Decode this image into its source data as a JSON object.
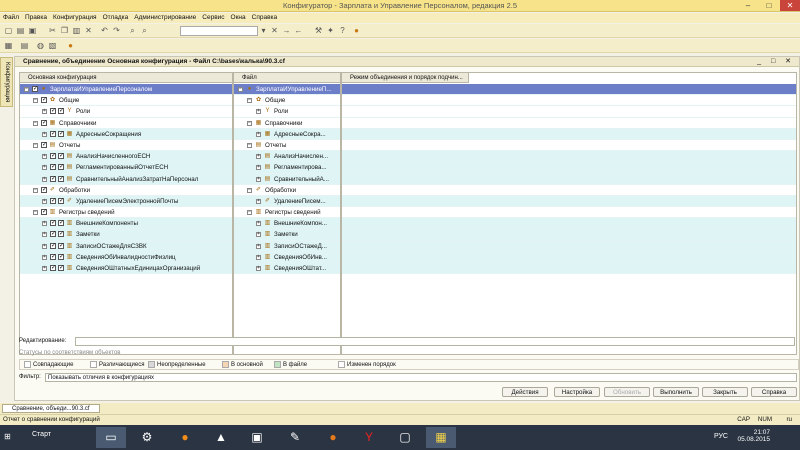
{
  "window_title": "Конфигуратор - Зарплата и Управление Персоналом, редакция 2.5",
  "menu": [
    "Файл",
    "Правка",
    "Конфигурация",
    "Отладка",
    "Администрирование",
    "Сервис",
    "Окна",
    "Справка"
  ],
  "side_tab": "Конфигурация",
  "doc_title": "Сравнение, объединение Основная конфигурация - Файл C:\\bases\\калька\\90.3.cf",
  "columns": {
    "left": "Основная конфигурация",
    "mid": "Файл",
    "right": "Режим объединения и порядок подчин..."
  },
  "tree": [
    {
      "level": 0,
      "left": "ЗарплатаИУправлениеПерсоналом",
      "mid": "ЗарплатаИУправлениеП...",
      "sel": true,
      "icon": "config-icon"
    },
    {
      "level": 1,
      "left": "Общие",
      "mid": "Общие",
      "icon": "common-icon"
    },
    {
      "level": 2,
      "left": "Роли",
      "mid": "Роли",
      "icon": "role-icon"
    },
    {
      "level": 1,
      "left": "Справочники",
      "mid": "Справочники",
      "icon": "catalog-icon"
    },
    {
      "level": 2,
      "left": "АдресныеСокращения",
      "mid": "АдресныеСокра...",
      "alt": true,
      "icon": "catalog-icon"
    },
    {
      "level": 1,
      "left": "Отчеты",
      "mid": "Отчеты",
      "icon": "report-icon"
    },
    {
      "level": 2,
      "left": "АнализНачисленногоЕСН",
      "mid": "АнализНачислен...",
      "alt": true,
      "icon": "report-icon"
    },
    {
      "level": 2,
      "left": "РегламентированныйОтчетЕСН",
      "mid": "Регламентирова...",
      "alt": true,
      "icon": "report-icon"
    },
    {
      "level": 2,
      "left": "СравнительныйАнализЗатратНаПерсонал",
      "mid": "СравнительныйА...",
      "alt": true,
      "icon": "report-icon"
    },
    {
      "level": 1,
      "left": "Обработки",
      "mid": "Обработки",
      "icon": "processing-icon"
    },
    {
      "level": 2,
      "left": "УдалениеПисемЭлектроннойПочты",
      "mid": "УдалениеПисем...",
      "alt": true,
      "icon": "processing-icon"
    },
    {
      "level": 1,
      "left": "Регистры сведений",
      "mid": "Регистры сведений",
      "icon": "register-icon"
    },
    {
      "level": 2,
      "left": "ВнешниеКомпоненты",
      "mid": "ВнешниеКомпон...",
      "alt": true,
      "icon": "register-icon"
    },
    {
      "level": 2,
      "left": "Заметки",
      "mid": "Заметки",
      "alt": true,
      "icon": "register-icon"
    },
    {
      "level": 2,
      "left": "ЗаписиОСтажеДляСЗВК",
      "mid": "ЗаписиОСтажеД...",
      "alt": true,
      "icon": "register-icon"
    },
    {
      "level": 2,
      "left": "СведенияОбИнвалидностиФизлиц",
      "mid": "СведенияОбИнв...",
      "alt": true,
      "icon": "register-icon"
    },
    {
      "level": 2,
      "left": "СведенияОШтатныхЕдиницахОрганизаций",
      "mid": "СведенияОШтат...",
      "alt": true,
      "icon": "register-icon"
    }
  ],
  "edit_label": "Редактирование:",
  "legend_title": "Статусы по соответствиям объектов",
  "legend": [
    {
      "label": "Совпадающие",
      "color": "#ffffff"
    },
    {
      "label": "Различающиеся",
      "color": "#ffffff"
    },
    {
      "label": "Неопределенные",
      "color": "#d8d8d8"
    },
    {
      "label": "В основной",
      "color": "#f6d6b2"
    },
    {
      "label": "В файле",
      "color": "#bfe3c3"
    },
    {
      "label": "Изменен порядок",
      "color": "#ffffff"
    }
  ],
  "filter_label": "Фильтр:",
  "filter_value": "Показывать отличия в конфигурациях",
  "buttons": {
    "actions": "Действия",
    "settings": "Настройка",
    "refresh": "Обновить",
    "execute": "Выполнить",
    "close": "Закрыть",
    "help": "Справка"
  },
  "window_tab": "Сравнение, объеди...90.3.cf",
  "status_text": "Отчет о сравнении конфигураций",
  "status_right": [
    "CAP",
    "NUM",
    "ru"
  ],
  "taskbar": {
    "start": "Старт",
    "lang": "РУС",
    "time": "21:07",
    "date": "05.08.2015"
  }
}
